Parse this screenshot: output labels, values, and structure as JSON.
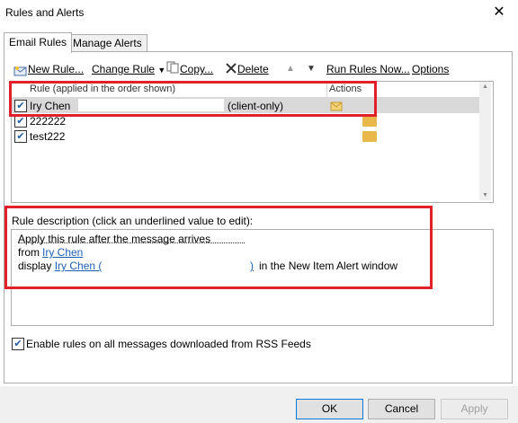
{
  "window": {
    "title": "Rules and Alerts",
    "close_glyph": "✕"
  },
  "tabs": [
    {
      "label": "Email Rules"
    },
    {
      "label": "Manage Alerts"
    }
  ],
  "toolbar": {
    "new_rule": "New Rule...",
    "change_rule": "Change Rule",
    "copy": "Copy...",
    "delete": "Delete",
    "run_rules": "Run Rules Now...",
    "options": "Options"
  },
  "list": {
    "col_rule": "Rule (applied in the order shown)",
    "col_actions": "Actions",
    "rows": [
      {
        "name": "Iry Chen",
        "tag": "(client-only)",
        "checked": true
      },
      {
        "name": "222222",
        "tag": "",
        "checked": true
      },
      {
        "name": "test222",
        "tag": "",
        "checked": true
      }
    ]
  },
  "description": {
    "label": "Rule description (click an underlined value to edit):",
    "line1": "Apply this rule after the message arrives",
    "line2_prefix": "from",
    "line2_link": "Iry Chen",
    "line3_prefix": "display",
    "line3_link": "Iry Chen (",
    "line3_link_end": ")",
    "line3_suffix": "in the New Item Alert window"
  },
  "rss": {
    "label": "Enable rules on all messages downloaded from RSS Feeds",
    "checked": true
  },
  "buttons": {
    "ok": "OK",
    "cancel": "Cancel",
    "apply": "Apply"
  },
  "colors": {
    "highlight_red": "#e0202a",
    "link_blue": "#1c5fb5"
  }
}
